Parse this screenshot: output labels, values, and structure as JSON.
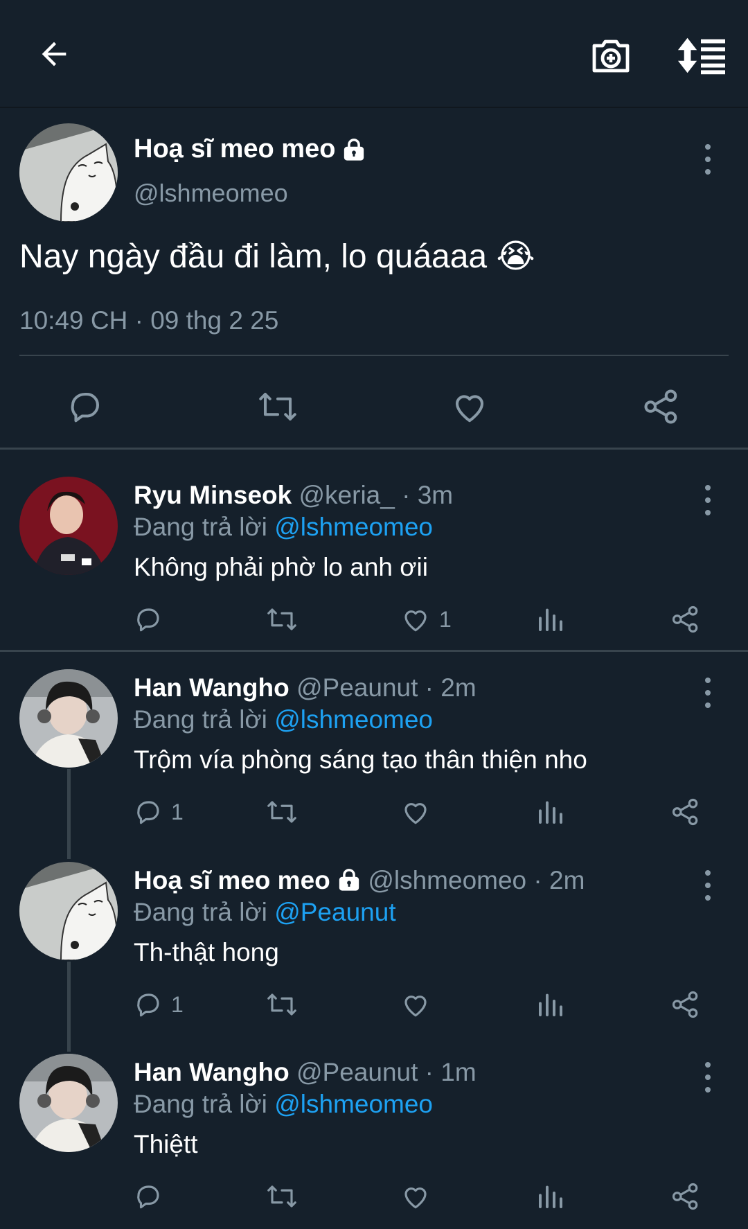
{
  "icons": {
    "back": "arrow-left-icon",
    "camera": "camera-plus-icon",
    "sort": "sort-thread-icon",
    "more": "more-vertical-icon",
    "lock": "lock-icon",
    "reply": "reply-icon",
    "retweet": "retweet-icon",
    "like": "heart-icon",
    "share": "share-icon",
    "analytics": "analytics-icon"
  },
  "colors": {
    "background": "#15202b",
    "secondary_text": "#8899a6",
    "mention": "#1da1f2",
    "divider": "#38444d"
  },
  "main_tweet": {
    "author_name": "Hoạ sĩ meo meo",
    "author_handle": "@lshmeomeo",
    "text": "Nay ngày đầu đi làm, lo quáaaa 😭",
    "timestamp": "10:49 CH · 09 thg 2 25"
  },
  "replies": [
    {
      "name": "Ryu Minseok",
      "meta": "@keria_ · 3m",
      "reply_prefix": "Đang trả lời",
      "mention": "@lshmeomeo",
      "text": "Không phải phờ lo anh ơii",
      "reply_count": "",
      "like_count": "1"
    },
    {
      "name": "Han Wangho",
      "meta": "@Peaunut · 2m",
      "reply_prefix": "Đang trả lời",
      "mention": "@lshmeomeo",
      "text": "Trộm vía phòng sáng tạo thân thiện nho",
      "reply_count": "1",
      "like_count": ""
    },
    {
      "name": "Hoạ sĩ meo meo",
      "meta": "@lshmeomeo · 2m",
      "reply_prefix": "Đang trả lời",
      "mention": "@Peaunut",
      "text": "Th-thật hong",
      "reply_count": "1",
      "like_count": ""
    },
    {
      "name": "Han Wangho",
      "meta": "@Peaunut · 1m",
      "reply_prefix": "Đang trả lời",
      "mention": "@lshmeomeo",
      "text": "Thiệtt",
      "reply_count": "",
      "like_count": ""
    }
  ]
}
